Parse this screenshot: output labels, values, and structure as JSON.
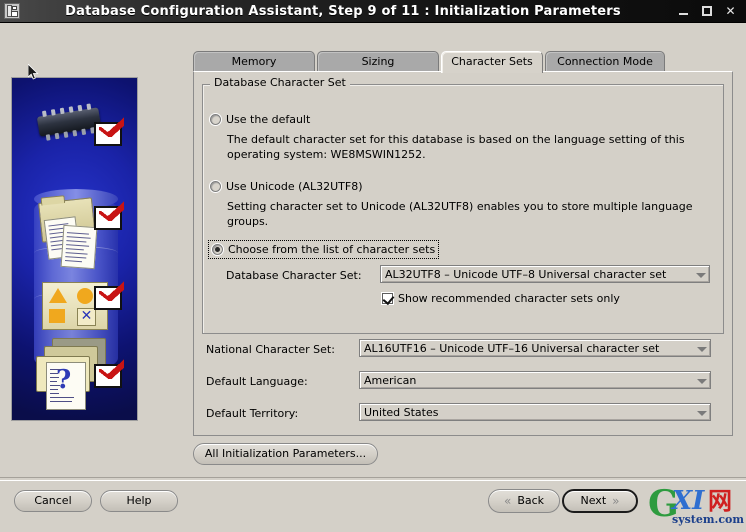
{
  "window": {
    "title": "Database Configuration Assistant, Step 9 of 11 : Initialization Parameters",
    "icon": "app-icon",
    "controls": {
      "minimize": "_",
      "maximize": "□",
      "close": "✕"
    }
  },
  "tabs": [
    {
      "label": "Memory",
      "active": false
    },
    {
      "label": "Sizing",
      "active": false
    },
    {
      "label": "Character Sets",
      "active": true
    },
    {
      "label": "Connection Mode",
      "active": false
    }
  ],
  "group": {
    "title": "Database Character Set",
    "options": [
      {
        "label": "Use the default",
        "selected": false,
        "description": "The default character set for this database is based on the language setting of this operating system: WE8MSWIN1252."
      },
      {
        "label": "Use Unicode (AL32UTF8)",
        "selected": false,
        "description": "Setting character set to Unicode (AL32UTF8) enables you to store multiple language groups."
      },
      {
        "label": "Choose from the list of character sets",
        "selected": true,
        "focused": true,
        "description": ""
      }
    ],
    "database_charset": {
      "label": "Database Character Set:",
      "value": "AL32UTF8 – Unicode UTF–8 Universal character set"
    },
    "recommended_checkbox": {
      "label": "Show recommended character sets only",
      "checked": true
    }
  },
  "fields": [
    {
      "label": "National Character Set:",
      "value": "AL16UTF16 – Unicode UTF–16 Universal character set"
    },
    {
      "label": "Default Language:",
      "value": "American"
    },
    {
      "label": "Default Territory:",
      "value": "United States"
    }
  ],
  "buttons": {
    "all_init_params": "All Initialization Parameters...",
    "cancel": "Cancel",
    "help": "Help",
    "back": "Back",
    "next": "Next",
    "back_chevron": "«",
    "next_chevron": "»"
  },
  "watermark": {
    "g": "G",
    "xi": "XI",
    "cn": "网",
    "site": "system.com"
  },
  "colors": {
    "face": "#d4d0c8",
    "titlebar": "#111111",
    "tab_inactive": "#a9a9a9",
    "sidebar_blue": "#1a23a8",
    "check_red": "#c81414"
  }
}
